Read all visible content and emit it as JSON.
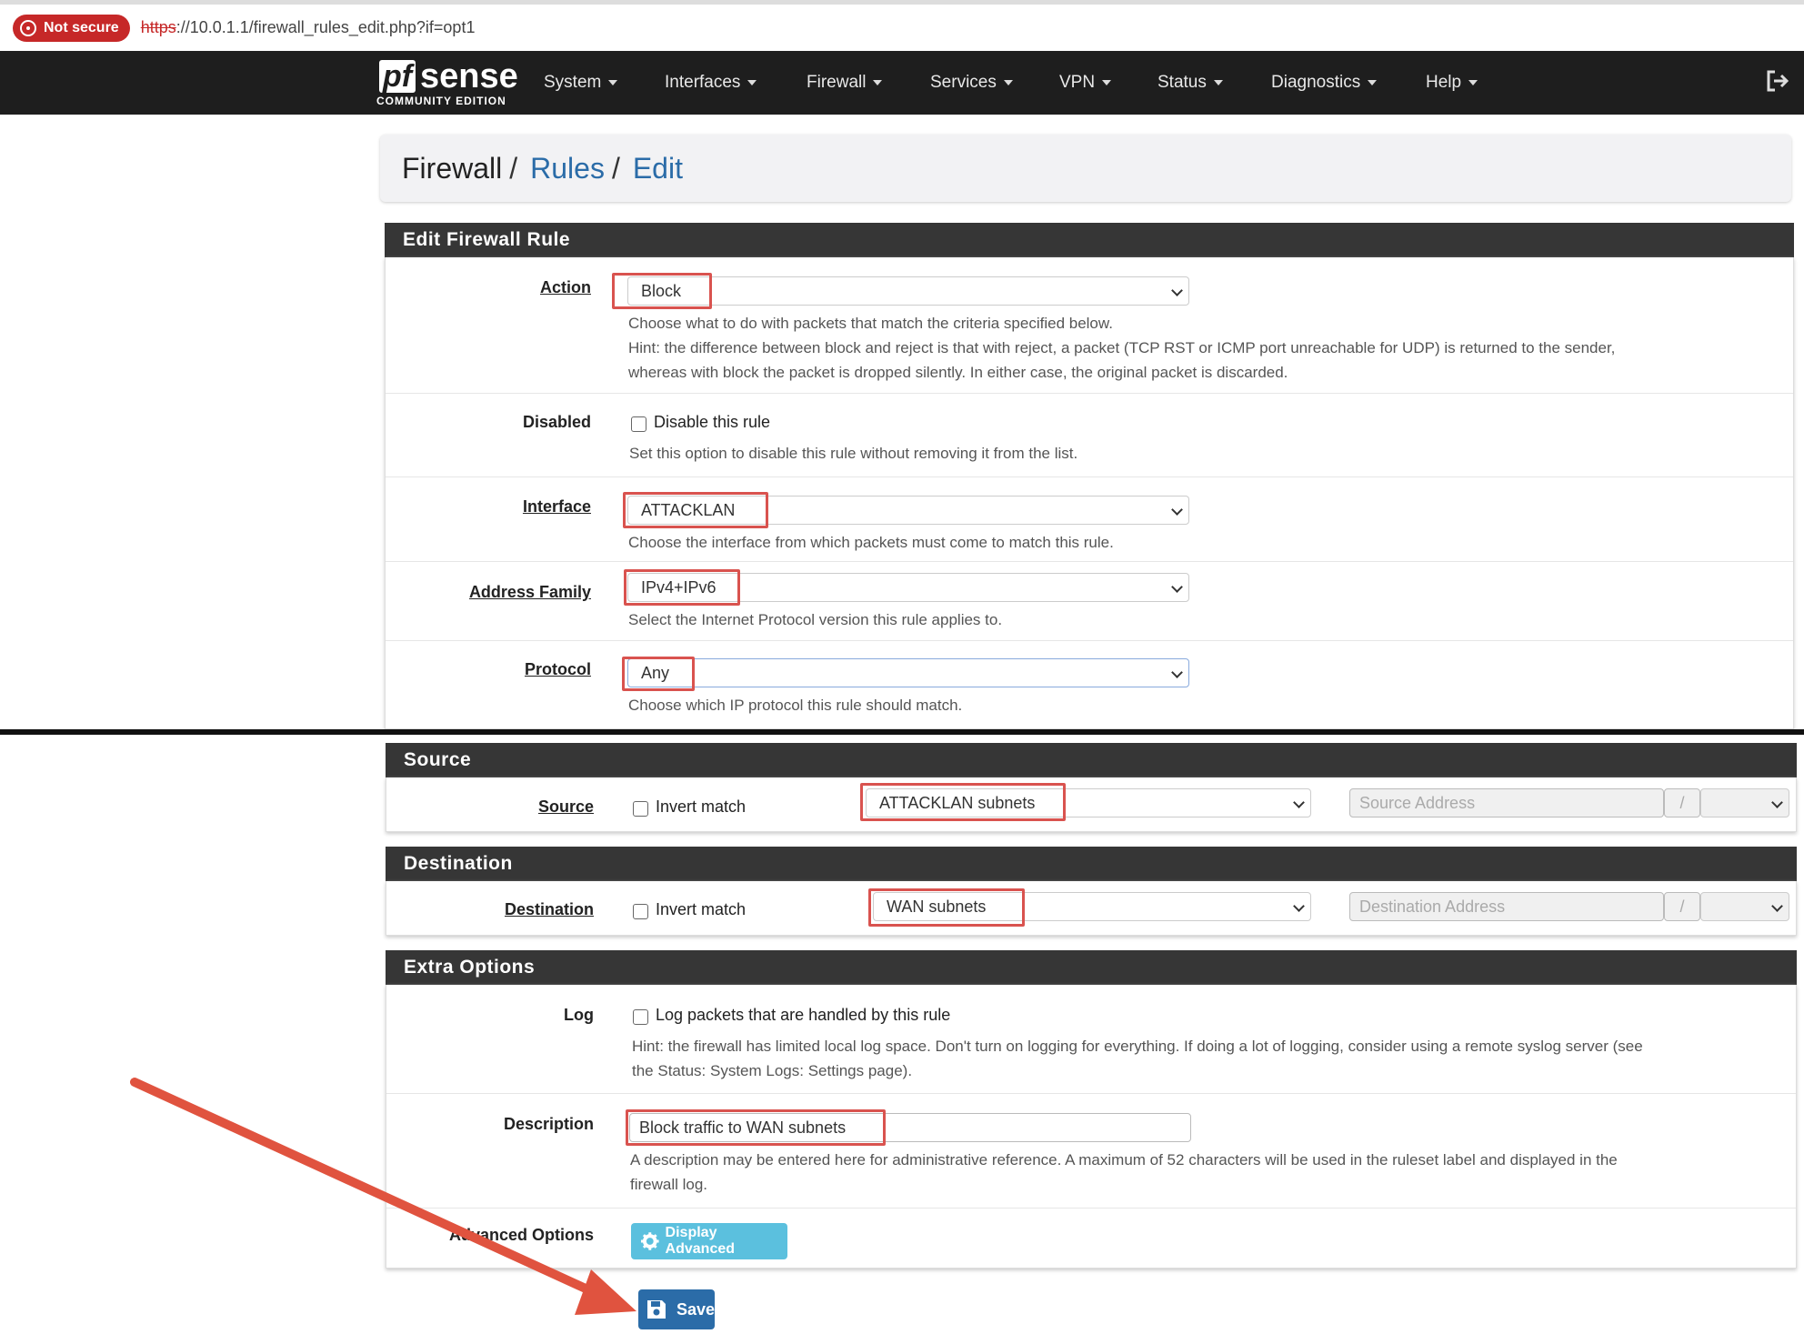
{
  "browser": {
    "not_secure": "Not secure",
    "url_scheme": "https",
    "url_rest": "://10.0.1.1/firewall_rules_edit.php?if=opt1"
  },
  "nav": {
    "logo_pf": "pf",
    "logo_sense": "sense",
    "logo_edition": "COMMUNITY EDITION",
    "menu": [
      "System",
      "Interfaces",
      "Firewall",
      "Services",
      "VPN",
      "Status",
      "Diagnostics",
      "Help"
    ]
  },
  "breadcrumb": {
    "root": "Firewall",
    "rules": "Rules",
    "edit": "Edit",
    "sep": "/"
  },
  "edit_rule": {
    "title": "Edit Firewall Rule",
    "action": {
      "label": "Action",
      "value": "Block",
      "help1": "Choose what to do with packets that match the criteria specified below.",
      "help2": "Hint: the difference between block and reject is that with reject, a packet (TCP RST or ICMP port unreachable for UDP) is returned to the sender,",
      "help3": "whereas with block the packet is dropped silently. In either case, the original packet is discarded."
    },
    "disabled": {
      "label": "Disabled",
      "checkbox": "Disable this rule",
      "help": "Set this option to disable this rule without removing it from the list."
    },
    "interface": {
      "label": "Interface",
      "value": "ATTACKLAN",
      "help": "Choose the interface from which packets must come to match this rule."
    },
    "address_family": {
      "label": "Address Family",
      "value": "IPv4+IPv6",
      "help": "Select the Internet Protocol version this rule applies to."
    },
    "protocol": {
      "label": "Protocol",
      "value": "Any",
      "help": "Choose which IP protocol this rule should match."
    }
  },
  "source": {
    "title": "Source",
    "label": "Source",
    "invert": "Invert match",
    "value": "ATTACKLAN subnets",
    "address_placeholder": "Source Address",
    "slash": "/"
  },
  "destination": {
    "title": "Destination",
    "label": "Destination",
    "invert": "Invert match",
    "value": "WAN subnets",
    "address_placeholder": "Destination Address",
    "slash": "/"
  },
  "extra": {
    "title": "Extra Options",
    "log": {
      "label": "Log",
      "checkbox": "Log packets that are handled by this rule",
      "help1": "Hint: the firewall has limited local log space. Don't turn on logging for everything. If doing a lot of logging, consider using a remote syslog server (see",
      "help2": "the Status: System Logs: Settings page)."
    },
    "description": {
      "label": "Description",
      "value": "Block traffic to WAN subnets",
      "help1": "A description may be entered here for administrative reference. A maximum of 52 characters will be used in the ruleset label and displayed in the",
      "help2": "firewall log."
    },
    "advanced": {
      "label": "Advanced Options",
      "button": "Display Advanced"
    }
  },
  "save_button": "Save",
  "colors": {
    "navbar": "#1e1e1e",
    "panel_header": "#363636",
    "highlight": "#d9534f",
    "primary": "#2b6ca8",
    "info": "#5bc0de",
    "annotation_arrow": "#e0533f"
  },
  "icons": [
    "sliders-icon",
    "chart-icon",
    "list-icon",
    "help-icon",
    "logout-icon",
    "gear-icon",
    "floppy-icon"
  ]
}
